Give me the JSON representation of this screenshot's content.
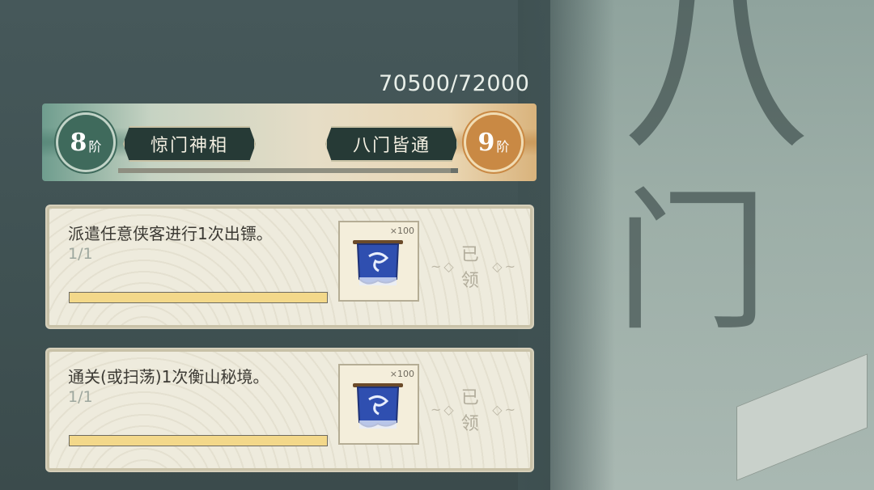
{
  "score": {
    "current": "70500",
    "separator": "/",
    "total": "72000",
    "text": "70500/72000"
  },
  "stage": {
    "current_level_num": "8",
    "current_level_unit": "阶",
    "current_title": "惊门神相",
    "next_level_num": "9",
    "next_level_unit": "阶",
    "next_title": "八门皆通",
    "progress_fraction": 0.979
  },
  "tasks": [
    {
      "description": "派遣任意侠客进行1次出镖。",
      "count": "1/1",
      "progress_fraction": 1.0,
      "reward_quantity": "×100",
      "reward_icon": "sect-banner-icon",
      "status": "已领"
    },
    {
      "description": "通关(或扫荡)1次衡山秘境。",
      "count": "1/1",
      "progress_fraction": 1.0,
      "reward_quantity": "×100",
      "reward_icon": "sect-banner-icon",
      "status": "已领"
    }
  ],
  "colors": {
    "current_badge": "#3f6a5c",
    "next_badge": "#c98944",
    "progress_fill": "#f3d88a"
  }
}
